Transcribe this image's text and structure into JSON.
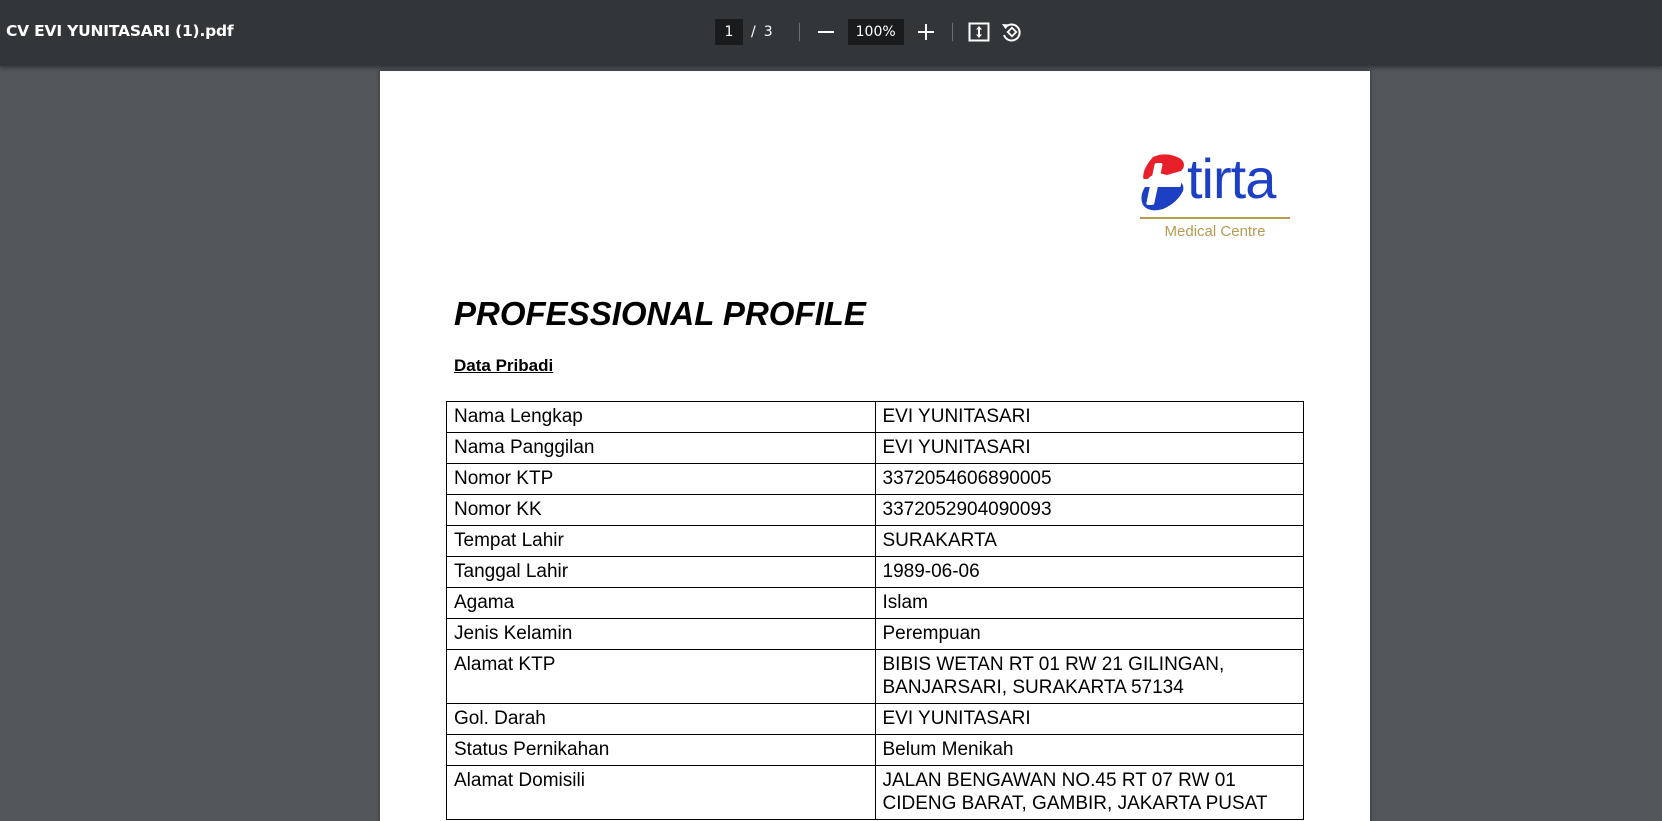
{
  "toolbar": {
    "title": "CV EVI YUNITASARI (1).pdf",
    "current_page": "1",
    "page_separator": "/",
    "total_pages": "3",
    "zoom": "100%",
    "icons": {
      "zoom_out": "minus-icon",
      "zoom_in": "plus-icon",
      "fit": "fit-to-page-icon",
      "rotate": "rotate-icon"
    }
  },
  "document": {
    "logo": {
      "name": "tirta",
      "subtitle": "Medical Centre",
      "colors": {
        "red": "#e8202a",
        "blue": "#1d3fc4",
        "gold": "#b79a52"
      }
    },
    "heading": "PROFESSIONAL PROFILE",
    "section_title": "Data Pribadi",
    "rows": [
      {
        "label": "Nama Lengkap",
        "value": "EVI YUNITASARI"
      },
      {
        "label": "Nama Panggilan",
        "value": "EVI YUNITASARI"
      },
      {
        "label": "Nomor KTP",
        "value": "3372054606890005"
      },
      {
        "label": "Nomor KK",
        "value": "3372052904090093"
      },
      {
        "label": "Tempat Lahir",
        "value": "SURAKARTA"
      },
      {
        "label": "Tanggal Lahir",
        "value": "1989-06-06"
      },
      {
        "label": "Agama",
        "value": "Islam"
      },
      {
        "label": "Jenis Kelamin",
        "value": "Perempuan"
      },
      {
        "label": "Alamat KTP",
        "value_lines": [
          "BIBIS WETAN RT 01 RW 21 GILINGAN,",
          "BANJARSARI, SURAKARTA 57134"
        ]
      },
      {
        "label": "Gol. Darah",
        "value": "EVI YUNITASARI"
      },
      {
        "label": "Status Pernikahan",
        "value": "Belum Menikah"
      },
      {
        "label": "Alamat Domisili",
        "value_lines": [
          "JALAN BENGAWAN NO.45 RT 07 RW 01",
          "CIDENG BARAT, GAMBIR, JAKARTA PUSAT"
        ]
      }
    ]
  }
}
